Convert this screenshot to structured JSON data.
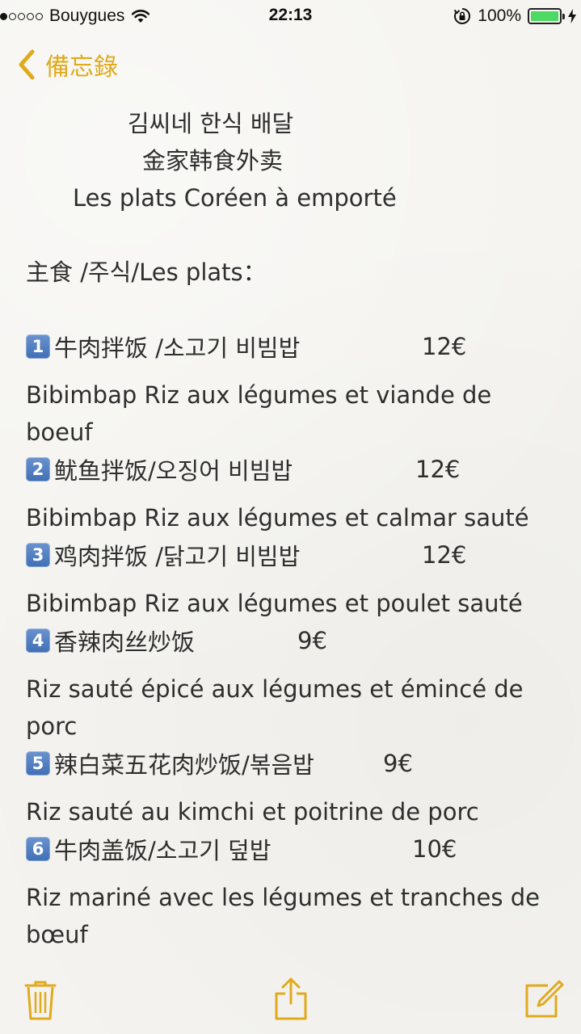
{
  "status_bar": {
    "carrier": "Bouygues",
    "signal_strength": "1 of 5",
    "time": "22:13",
    "battery_percent": "100%",
    "battery_level": 1.0,
    "battery_color": "#4cd964",
    "icons": [
      "wifi-icon",
      "rotation-lock-icon",
      "battery-icon",
      "charging-icon"
    ]
  },
  "nav": {
    "back_label": "備忘錄",
    "back_icon": "chevron-left-icon",
    "accent_color": "#e0aa1c"
  },
  "note": {
    "title_lines": [
      "김씨네  한식 배달",
      "金家韩食外卖",
      "Les plats Coréen à emporté"
    ],
    "section_heading": "主食 /주식/Les plats：",
    "items": [
      {
        "number": "1",
        "name": "牛肉拌饭 /소고기 비빔밥",
        "price": "12€",
        "description": "Bibimbap Riz aux légumes et viande de boeuf"
      },
      {
        "number": "2",
        "name": "鱿鱼拌饭/오징어 비빔밥",
        "price": "12€",
        "description": "Bibimbap Riz aux légumes et calmar sauté"
      },
      {
        "number": "3",
        "name": "鸡肉拌饭 /닭고기 비빔밥",
        "price": "12€",
        "description": "Bibimbap Riz aux légumes et poulet sauté"
      },
      {
        "number": "4",
        "name": "香辣肉丝炒饭",
        "price": "9€",
        "description": "Riz sauté épicé aux légumes et émincé de porc"
      },
      {
        "number": "5",
        "name": "辣白菜五花肉炒饭/볶음밥",
        "price": "9€",
        "description": "Riz sauté au kimchi et poitrine de porc"
      },
      {
        "number": "6",
        "name": "牛肉盖饭/소고기 덮밥",
        "price": "10€",
        "description": "Riz mariné avec les légumes et tranches de bœuf"
      }
    ]
  },
  "toolbar": {
    "icons": [
      "trash-icon",
      "share-icon",
      "compose-icon"
    ]
  }
}
